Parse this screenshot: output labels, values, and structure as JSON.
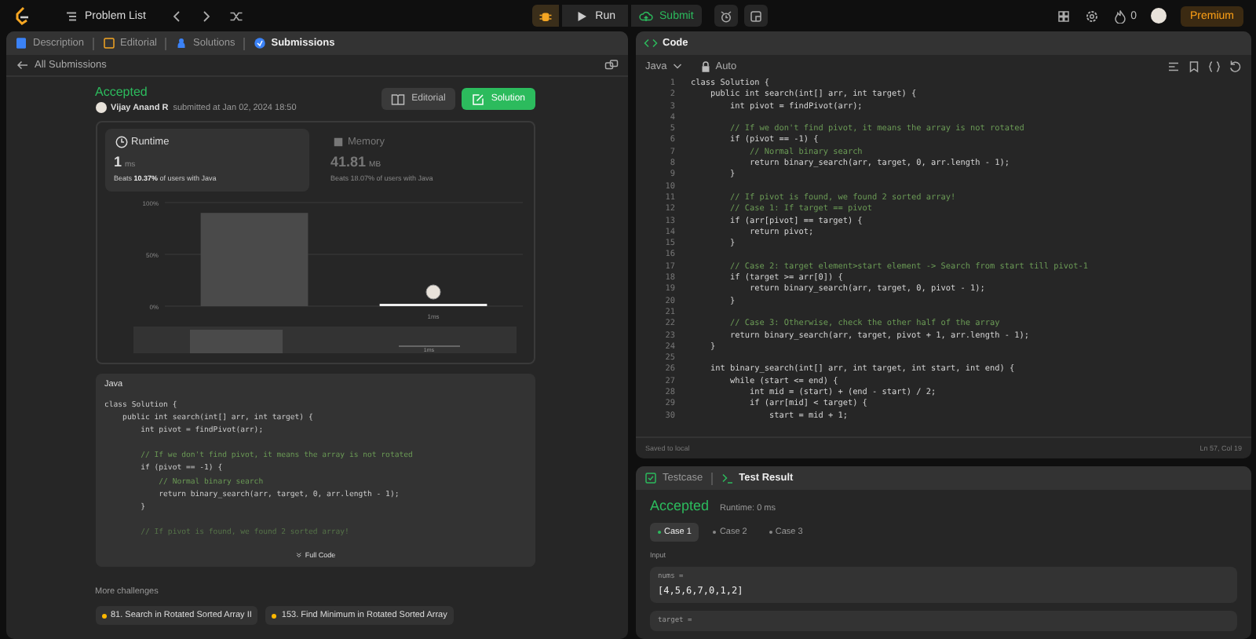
{
  "top_bar": {
    "problem_list": "Problem List",
    "run": "Run",
    "submit": "Submit",
    "streak": "0",
    "premium": "Premium"
  },
  "left_panel": {
    "tabs": [
      {
        "label": "Description",
        "selected": false
      },
      {
        "label": "Editorial",
        "selected": false
      },
      {
        "label": "Solutions",
        "selected": false
      },
      {
        "label": "Submissions",
        "selected": true
      }
    ],
    "back": "All Submissions",
    "status": "Accepted",
    "author": "Vijay Anand R",
    "submitted": "submitted at Jan 02, 2024 18:50",
    "buttons": [
      {
        "label": "Editorial",
        "kind": "plain"
      },
      {
        "label": "Solution",
        "kind": "primary"
      }
    ],
    "stats": [
      {
        "label": "Runtime",
        "value": "1",
        "unit": "ms",
        "beats": "Beats **10.37%** of users with Java",
        "selected": true
      },
      {
        "label": "Memory",
        "value": "41.81",
        "unit": "MB",
        "beats": "Beats 18.07% of users with Java",
        "selected": false
      }
    ],
    "chart_data": {
      "type": "bar",
      "categories": [
        null,
        "1ms"
      ],
      "values": [
        90,
        2
      ],
      "ylim": [
        0,
        100
      ],
      "yticks": [
        {
          "value": 100,
          "label": "100%"
        },
        {
          "value": 50,
          "label": "50%"
        },
        {
          "value": 0,
          "label": "0%"
        }
      ]
    },
    "navigator_label": "1ms",
    "preview": {
      "language": "Java",
      "lines": [
        {
          "code": "class Solution {",
          "kind": "code"
        },
        {
          "code": "    public int search(int[] arr, int target) {",
          "kind": "code"
        },
        {
          "code": "        int pivot = findPivot(arr);",
          "kind": "code"
        },
        {
          "kind": "blank"
        },
        {
          "code": "        // If we don't find pivot, it means the array is not rotated",
          "kind": "comment"
        },
        {
          "code": "        if (pivot == -1) {",
          "kind": "code"
        },
        {
          "code": "            // Normal binary search",
          "kind": "comment"
        },
        {
          "code": "            return binary_search(arr, target, 0, arr.length - 1);",
          "kind": "code"
        },
        {
          "code": "        }",
          "kind": "code"
        },
        {
          "kind": "blank"
        },
        {
          "code": "        // If pivot is found, we found 2 sorted array!",
          "kind": "comment"
        }
      ],
      "full_code": "Full Code"
    },
    "more_title": "More challenges",
    "challenges": [
      {
        "label": "81. Search in Rotated Sorted Array II",
        "color": "#ffb800"
      },
      {
        "label": "153. Find Minimum in Rotated Sorted Array",
        "color": "#ffb800"
      }
    ]
  },
  "code_panel": {
    "title": "Code",
    "language": "Java",
    "mode": "Auto",
    "lines": [
      {
        "n": "1",
        "code": "class Solution {",
        "kind": "code"
      },
      {
        "n": "2",
        "code": "    public int search(int[] arr, int target) {",
        "kind": "code"
      },
      {
        "n": "3",
        "code": "        int pivot = findPivot(arr);",
        "kind": "code"
      },
      {
        "n": "4",
        "kind": "blank"
      },
      {
        "n": "5",
        "code": "        // If we don't find pivot, it means the array is not rotated",
        "kind": "comment"
      },
      {
        "n": "6",
        "code": "        if (pivot == -1) {",
        "kind": "code"
      },
      {
        "n": "7",
        "code": "            // Normal binary search",
        "kind": "comment"
      },
      {
        "n": "8",
        "code": "            return binary_search(arr, target, 0, arr.length - 1);",
        "kind": "code"
      },
      {
        "n": "9",
        "code": "        }",
        "kind": "code"
      },
      {
        "n": "10",
        "kind": "blank"
      },
      {
        "n": "11",
        "code": "        // If pivot is found, we found 2 sorted array!",
        "kind": "comment"
      },
      {
        "n": "12",
        "code": "        // Case 1: If target == pivot",
        "kind": "comment"
      },
      {
        "n": "13",
        "code": "        if (arr[pivot] == target) {",
        "kind": "code"
      },
      {
        "n": "14",
        "code": "            return pivot;",
        "kind": "code"
      },
      {
        "n": "15",
        "code": "        }",
        "kind": "code"
      },
      {
        "n": "16",
        "kind": "blank"
      },
      {
        "n": "17",
        "code": "        // Case 2: target element>start element -> Search from start till pivot-1",
        "kind": "comment"
      },
      {
        "n": "18",
        "code": "        if (target >= arr[0]) {",
        "kind": "code"
      },
      {
        "n": "19",
        "code": "            return binary_search(arr, target, 0, pivot - 1);",
        "kind": "code"
      },
      {
        "n": "20",
        "code": "        }",
        "kind": "code"
      },
      {
        "n": "21",
        "kind": "blank"
      },
      {
        "n": "22",
        "code": "        // Case 3: Otherwise, check the other half of the array",
        "kind": "comment"
      },
      {
        "n": "23",
        "code": "        return binary_search(arr, target, pivot + 1, arr.length - 1);",
        "kind": "code"
      },
      {
        "n": "24",
        "code": "    }",
        "kind": "code"
      },
      {
        "n": "25",
        "kind": "blank"
      },
      {
        "n": "26",
        "code": "    int binary_search(int[] arr, int target, int start, int end) {",
        "kind": "code"
      },
      {
        "n": "27",
        "code": "        while (start <= end) {",
        "kind": "code"
      },
      {
        "n": "28",
        "code": "            int mid = (start) + (end - start) / 2;",
        "kind": "code"
      },
      {
        "n": "29",
        "code": "            if (arr[mid] < target) {",
        "kind": "code"
      },
      {
        "n": "30",
        "code": "                start = mid + 1;",
        "kind": "code"
      }
    ],
    "saved": "Saved to local",
    "cursor": "Ln 57, Col 19"
  },
  "result_panel": {
    "tabs": [
      {
        "label": "Testcase",
        "selected": false
      },
      {
        "label": "Test Result",
        "selected": true
      }
    ],
    "status": "Accepted",
    "runtime": "Runtime: 0 ms",
    "cases": [
      {
        "label": "Case 1",
        "selected": true
      },
      {
        "label": "Case 2",
        "selected": false
      },
      {
        "label": "Case 3",
        "selected": false
      }
    ],
    "input_label": "Input",
    "inputs": [
      {
        "name": "nums =",
        "value": "[4,5,6,7,0,1,2]"
      },
      {
        "name": "target ="
      }
    ]
  }
}
